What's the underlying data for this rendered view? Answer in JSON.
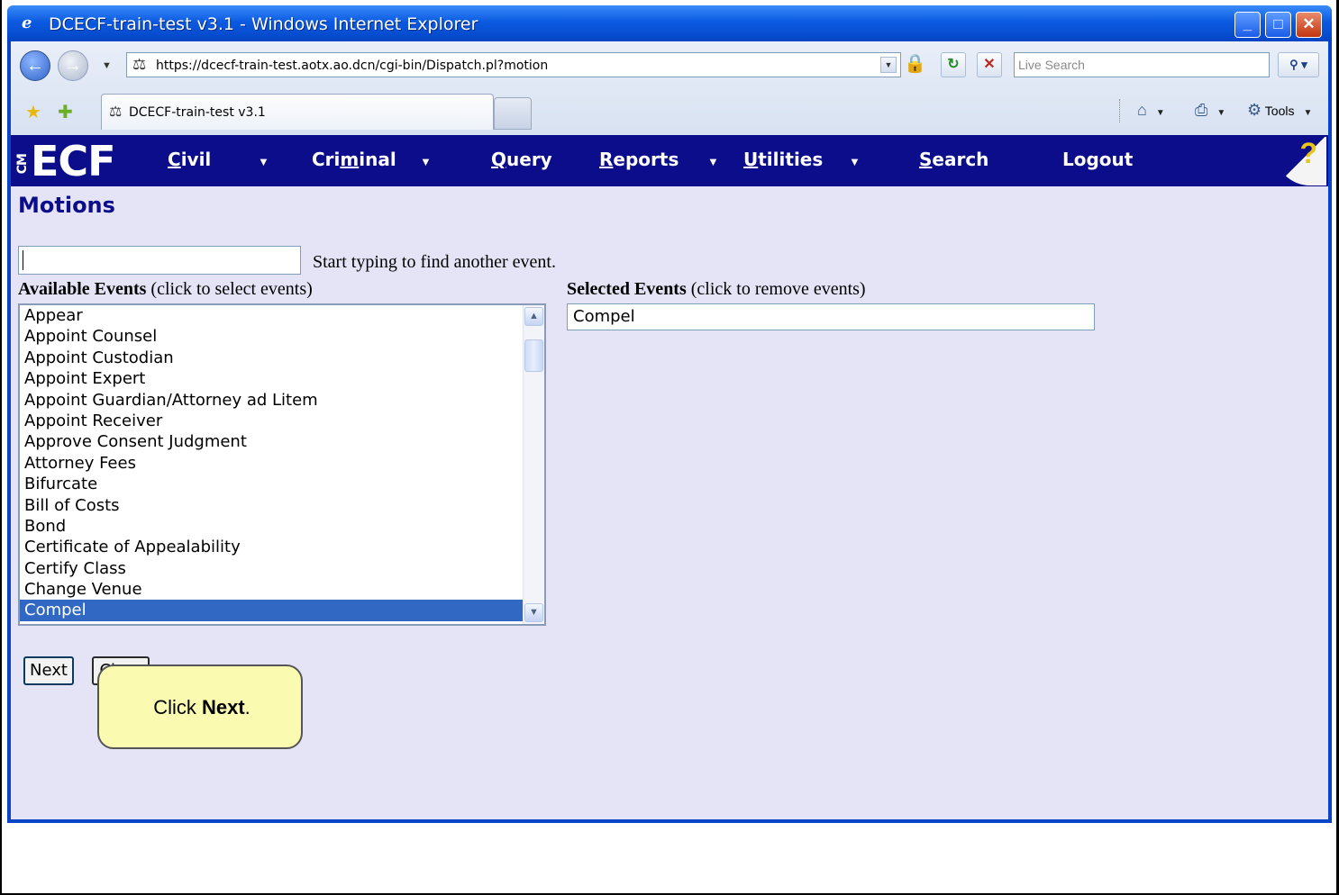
{
  "window": {
    "title": "DCECF-train-test v3.1 - Windows Internet Explorer",
    "minimize": "_",
    "maximize": "□",
    "close": "✕"
  },
  "browser": {
    "address": "https://dcecf-train-test.aotx.ao.dcn/cgi-bin/Dispatch.pl?motion",
    "search_placeholder": "Live Search",
    "tab_label": "DCECF-train-test v3.1",
    "tools_label": "Tools"
  },
  "ecf_menu": {
    "logo": "ECF",
    "logo_prefix": "CM",
    "items": [
      {
        "pre": "",
        "u": "C",
        "post": "ivil"
      },
      {
        "pre": "Cri",
        "u": "m",
        "post": "inal"
      },
      {
        "pre": "",
        "u": "Q",
        "post": "uery"
      },
      {
        "pre": "",
        "u": "R",
        "post": "eports"
      },
      {
        "pre": "",
        "u": "U",
        "post": "tilities"
      },
      {
        "pre": "",
        "u": "S",
        "post": "earch"
      },
      {
        "pre": "",
        "u": "",
        "post": "Logout"
      }
    ],
    "help": "?"
  },
  "page": {
    "title": "Motions",
    "search_hint": "Start typing to find another event.",
    "available_label_bold": "Available Events",
    "available_label_rest": " (click to select events)",
    "selected_label_bold": "Selected Events",
    "selected_label_rest": " (click to remove events)",
    "available_events": [
      "Appear",
      "Appoint Counsel",
      "Appoint Custodian",
      "Appoint Expert",
      "Appoint Guardian/Attorney ad Litem",
      "Appoint Receiver",
      "Approve Consent Judgment",
      "Attorney Fees",
      "Bifurcate",
      "Bill of Costs",
      "Bond",
      "Certificate of Appealability",
      "Certify Class",
      "Change Venue",
      "Compel"
    ],
    "selected_available": "Compel",
    "selected_events": [
      "Compel"
    ],
    "next_button": "Next",
    "clear_button": "Clear"
  },
  "callout": {
    "prefix": "Click ",
    "bold": "Next",
    "suffix": "."
  }
}
